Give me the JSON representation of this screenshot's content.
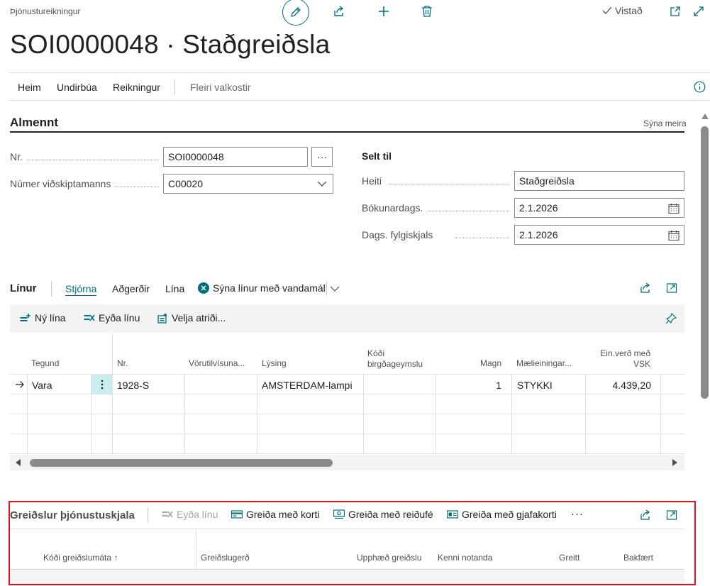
{
  "header": {
    "breadcrumb": "Þjónustureikningur",
    "title": "SOI0000048 · Staðgreiðsla",
    "saved_label": "Vistað"
  },
  "actionbar": {
    "items": [
      "Heim",
      "Undirbúa",
      "Reikningur"
    ],
    "more": "Fleiri valkostir"
  },
  "general": {
    "title": "Almennt",
    "show_more": "Sýna meira",
    "no_label": "Nr.",
    "no_value": "SOI0000048",
    "customer_no_label": "Númer viðskiptamanns",
    "customer_no_value": "C00020",
    "bill_to_heading": "Selt til",
    "name_label": "Heiti",
    "name_value": "Staðgreiðsla",
    "posting_date_label": "Bókunardags.",
    "posting_date_value": "2.1.2026",
    "document_date_label": "Dags. fylgiskjals",
    "document_date_value": "2.1.2026"
  },
  "lines": {
    "title": "Línur",
    "tabs": [
      "Stjórna",
      "Aðgerðir",
      "Lína"
    ],
    "issues_toggle": "Sýna línur með vandamál",
    "actions": {
      "new_line": "Ný lína",
      "delete_line": "Eyða línu",
      "select_items": "Velja atriði..."
    },
    "columns": {
      "type": "Tegund",
      "no": "Nr.",
      "item_reference": "Vörutilvísuna...",
      "description": "Lýsing",
      "location_code_1": "Kóði",
      "location_code_2": "birgðageymslu",
      "quantity": "Magn",
      "uom": "Mælieiningar...",
      "unit_price_1": "Ein.verð með",
      "unit_price_2": "VSK"
    },
    "rows": [
      {
        "type": "Vara",
        "no": "1928-S",
        "item_reference": "",
        "description": "AMSTERDAM-lampi",
        "location_code": "",
        "quantity": "1",
        "uom": "STYKKI",
        "unit_price": "4.439,20"
      }
    ]
  },
  "payments": {
    "title": "Greiðslur þjónustuskjala",
    "actions": {
      "delete_line": "Eyða línu",
      "pay_card": "Greiða með korti",
      "pay_cash": "Greiða með reiðufé",
      "pay_gift": "Greiða með gjafakorti",
      "more": "···"
    },
    "columns": {
      "method_code": "Kóði greiðslumáta ↑",
      "payment_type": "Greiðslugerð",
      "amount": "Upphæð greiðslu",
      "user_id": "Kenni notanda",
      "paid": "Greitt",
      "posted": "Bakfært"
    }
  },
  "colors": {
    "accent": "#00717a",
    "highlight_box": "#e0141e",
    "selected_cell": "#c9eef0"
  }
}
